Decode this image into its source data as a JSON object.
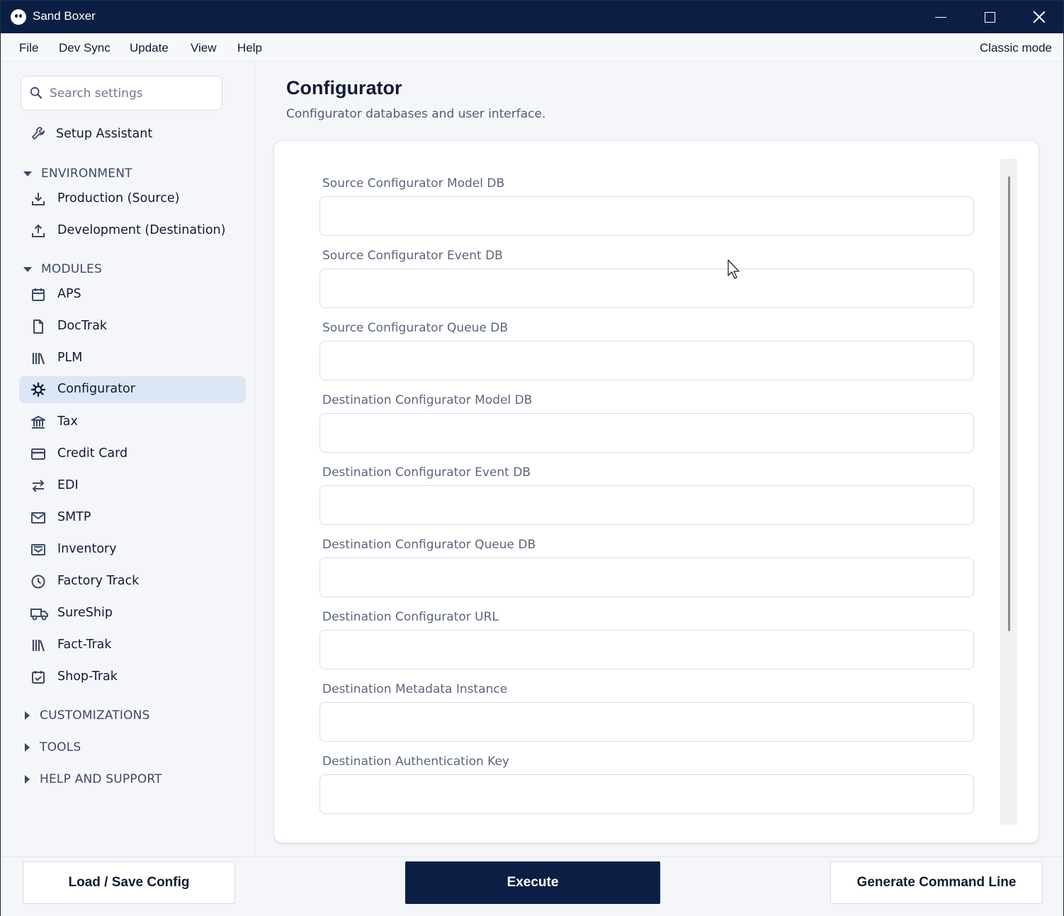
{
  "window": {
    "title": "Sand Boxer"
  },
  "menu": {
    "items": [
      "File",
      "Dev Sync",
      "Update",
      "View",
      "Help"
    ],
    "classic_mode": "Classic mode"
  },
  "sidebar": {
    "search_placeholder": "Search settings",
    "setup_assistant": "Setup Assistant",
    "sections": {
      "environment": "ENVIRONMENT",
      "modules": "MODULES",
      "customizations": "CUSTOMIZATIONS",
      "tools": "TOOLS",
      "help_support": "HELP AND SUPPORT"
    },
    "environment_items": [
      {
        "label": "Production (Source)",
        "icon": "download-icon"
      },
      {
        "label": "Development (Destination)",
        "icon": "upload-icon"
      }
    ],
    "module_items": [
      {
        "label": "APS",
        "icon": "calendar-icon"
      },
      {
        "label": "DocTrak",
        "icon": "document-icon"
      },
      {
        "label": "PLM",
        "icon": "library-icon"
      },
      {
        "label": "Configurator",
        "icon": "gear-icon"
      },
      {
        "label": "Tax",
        "icon": "bank-icon"
      },
      {
        "label": "Credit Card",
        "icon": "credit-card-icon"
      },
      {
        "label": "EDI",
        "icon": "exchange-icon"
      },
      {
        "label": "SMTP",
        "icon": "mail-icon"
      },
      {
        "label": "Inventory",
        "icon": "inbox-icon"
      },
      {
        "label": "Factory Track",
        "icon": "clock-icon"
      },
      {
        "label": "SureShip",
        "icon": "truck-icon"
      },
      {
        "label": "Fact-Trak",
        "icon": "library-icon"
      },
      {
        "label": "Shop-Trak",
        "icon": "calendar-check-icon"
      }
    ],
    "active_item": "Configurator"
  },
  "main": {
    "title": "Configurator",
    "subtitle": "Configurator databases and user interface.",
    "fields": [
      {
        "label": "Source Configurator Model DB",
        "value": ""
      },
      {
        "label": "Source Configurator Event DB",
        "value": ""
      },
      {
        "label": "Source Configurator Queue DB",
        "value": ""
      },
      {
        "label": "Destination Configurator Model DB",
        "value": ""
      },
      {
        "label": "Destination Configurator Event DB",
        "value": ""
      },
      {
        "label": "Destination Configurator Queue DB",
        "value": ""
      },
      {
        "label": "Destination Configurator URL",
        "value": ""
      },
      {
        "label": "Destination Metadata Instance",
        "value": ""
      },
      {
        "label": "Destination Authentication Key",
        "value": ""
      }
    ]
  },
  "footer": {
    "load_save": "Load / Save Config",
    "execute": "Execute",
    "generate": "Generate Command Line"
  },
  "colors": {
    "brand_navy": "#0b1f44",
    "active_bg": "#dde6f6"
  }
}
